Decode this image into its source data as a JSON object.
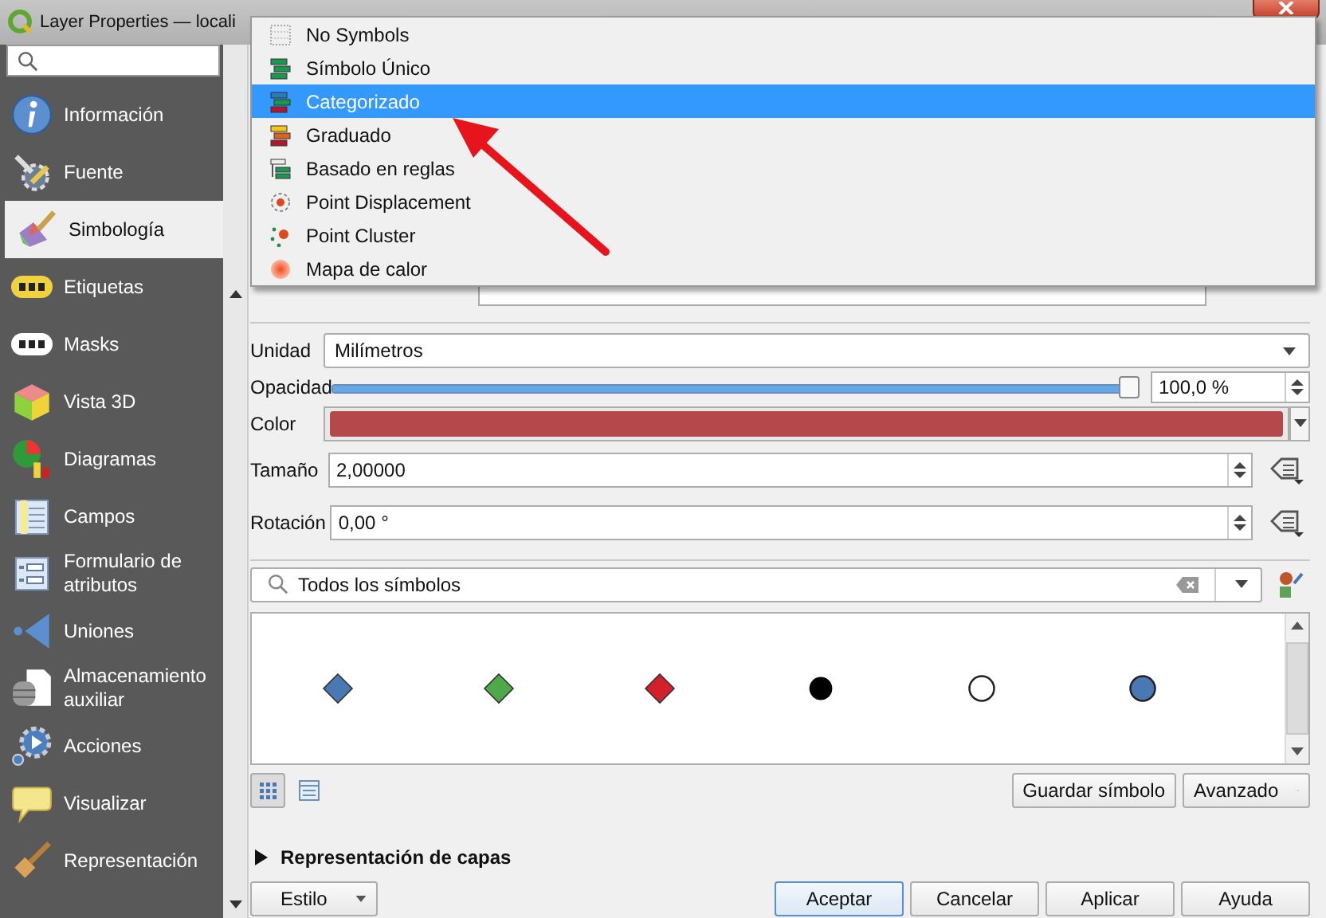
{
  "window": {
    "title": "Layer Properties — locali"
  },
  "sidebar": {
    "items": [
      {
        "label": "Información",
        "kind": "info",
        "selected": false
      },
      {
        "label": "Fuente",
        "kind": "source",
        "selected": false
      },
      {
        "label": "Simbología",
        "kind": "symbology",
        "selected": true
      },
      {
        "label": "Etiquetas",
        "kind": "labels",
        "selected": false
      },
      {
        "label": "Masks",
        "kind": "masks",
        "selected": false
      },
      {
        "label": "Vista 3D",
        "kind": "view3d",
        "selected": false
      },
      {
        "label": "Diagramas",
        "kind": "diagrams",
        "selected": false
      },
      {
        "label": "Campos",
        "kind": "fields",
        "selected": false
      },
      {
        "label": "Formulario de atributos",
        "kind": "form",
        "selected": false
      },
      {
        "label": "Uniones",
        "kind": "joins",
        "selected": false
      },
      {
        "label": "Almacenamiento auxiliar",
        "kind": "storage",
        "selected": false
      },
      {
        "label": "Acciones",
        "kind": "actions",
        "selected": false
      },
      {
        "label": "Visualizar",
        "kind": "display",
        "selected": false
      },
      {
        "label": "Representación",
        "kind": "rendering",
        "selected": false
      }
    ]
  },
  "renderer_menu": {
    "items": [
      {
        "label": "No Symbols",
        "kind": "none",
        "selected": false
      },
      {
        "label": "Símbolo Único",
        "kind": "single",
        "selected": false
      },
      {
        "label": "Categorizado",
        "kind": "categorized",
        "selected": true
      },
      {
        "label": "Graduado",
        "kind": "graduated",
        "selected": false
      },
      {
        "label": "Basado en reglas",
        "kind": "rules",
        "selected": false
      },
      {
        "label": "Point Displacement",
        "kind": "displacement",
        "selected": false
      },
      {
        "label": "Point Cluster",
        "kind": "cluster",
        "selected": false
      },
      {
        "label": "Mapa de calor",
        "kind": "heatmap",
        "selected": false
      }
    ]
  },
  "symbol": {
    "unit": {
      "label": "Unidad",
      "value": "Milímetros"
    },
    "opacity": {
      "label": "Opacidad",
      "level": 1,
      "reading": "100,0 %"
    },
    "color": {
      "label": "Color",
      "color": "#b5484b"
    },
    "size": {
      "label": "Tamaño",
      "value": "2,00000"
    },
    "rotation": {
      "label": "Rotación",
      "value": "0,00 °"
    }
  },
  "library": {
    "filter": "Todos los símbolos",
    "symbols": [
      {
        "kind": "diamond",
        "color": "#4a78b5"
      },
      {
        "kind": "diamond",
        "color": "#4fa84a"
      },
      {
        "kind": "diamond",
        "color": "#d4202a"
      },
      {
        "kind": "dot",
        "color": "#000000"
      },
      {
        "kind": "circle",
        "color": "#ffffff"
      },
      {
        "kind": "circle",
        "color": "#4a78b5"
      }
    ],
    "view_buttons": [
      {
        "kind": "icons",
        "selected": true
      },
      {
        "kind": "list",
        "selected": false
      }
    ],
    "save_button": "Guardar símbolo",
    "advanced_button": "Avanzado"
  },
  "layer_rendering": {
    "label": "Representación de capas",
    "expanded": false
  },
  "footer": {
    "style_button": "Estilo",
    "buttons": [
      {
        "label": "Aceptar",
        "default": true
      },
      {
        "label": "Cancelar",
        "default": false
      },
      {
        "label": "Aplicar",
        "default": false
      },
      {
        "label": "Ayuda",
        "default": false
      }
    ]
  }
}
